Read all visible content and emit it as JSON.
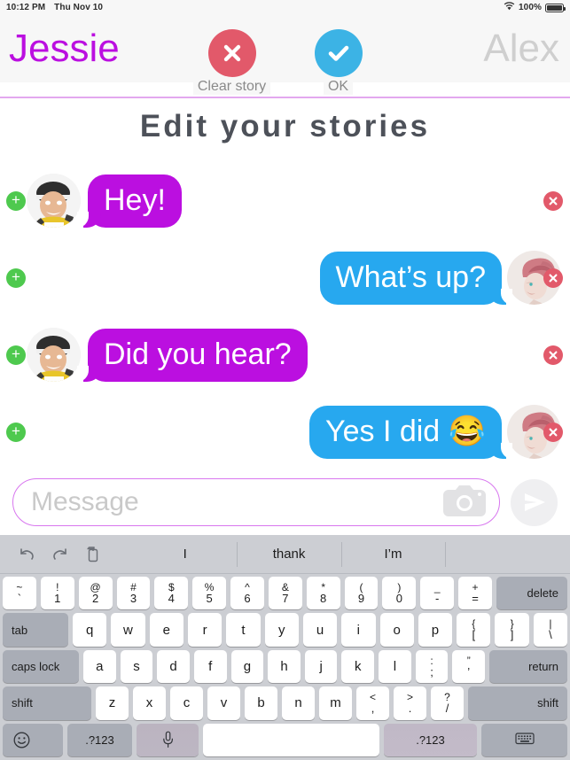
{
  "statusbar": {
    "time": "10:12 PM",
    "date": "Thu Nov 10",
    "battery": "100%"
  },
  "header": {
    "left_name": "Jessie",
    "right_name": "Alex",
    "clear_label": "Clear story",
    "ok_label": "OK"
  },
  "page_title": "Edit your stories",
  "messages": [
    {
      "text": "Hey!",
      "side": "in",
      "color": "purple"
    },
    {
      "text": "What’s up?",
      "side": "out",
      "color": "blue"
    },
    {
      "text": "Did you hear?",
      "side": "in",
      "color": "purple"
    },
    {
      "text": "Yes I did 😂",
      "side": "out",
      "color": "blue"
    }
  ],
  "input": {
    "placeholder": "Message",
    "value": ""
  },
  "keyboard": {
    "suggestions": [
      "I",
      "thank",
      "I’m"
    ],
    "tools": [
      "undo-icon",
      "redo-icon",
      "paste-icon"
    ],
    "row_num": [
      {
        "up": "~",
        "lo": "`"
      },
      {
        "up": "!",
        "lo": "1"
      },
      {
        "up": "@",
        "lo": "2"
      },
      {
        "up": "#",
        "lo": "3"
      },
      {
        "up": "$",
        "lo": "4"
      },
      {
        "up": "%",
        "lo": "5"
      },
      {
        "up": "^",
        "lo": "6"
      },
      {
        "up": "&",
        "lo": "7"
      },
      {
        "up": "*",
        "lo": "8"
      },
      {
        "up": "(",
        "lo": "9"
      },
      {
        "up": ")",
        "lo": "0"
      },
      {
        "up": "_",
        "lo": "-"
      },
      {
        "up": "+",
        "lo": "="
      }
    ],
    "delete_label": "delete",
    "tab_label": "tab",
    "row_q": [
      "q",
      "w",
      "e",
      "r",
      "t",
      "y",
      "u",
      "i",
      "o",
      "p"
    ],
    "row_q_dual": [
      {
        "up": "{",
        "lo": "["
      },
      {
        "up": "}",
        "lo": "]"
      },
      {
        "up": "|",
        "lo": "\\"
      }
    ],
    "caps_label": "caps lock",
    "row_a": [
      "a",
      "s",
      "d",
      "f",
      "g",
      "h",
      "j",
      "k",
      "l"
    ],
    "row_a_dual": [
      {
        "up": ":",
        "lo": ";"
      },
      {
        "up": "”",
        "lo": "’"
      }
    ],
    "return_label": "return",
    "shift_label": "shift",
    "row_z": [
      "z",
      "x",
      "c",
      "v",
      "b",
      "n",
      "m"
    ],
    "row_z_dual": [
      {
        "up": "<",
        "lo": ","
      },
      {
        "up": ">",
        "lo": "."
      },
      {
        "up": "?",
        "lo": "/"
      }
    ],
    "num_label": ".?123",
    "num_label_right": ".?123",
    "space_label": ""
  },
  "colors": {
    "purple": "#bb0fe0",
    "blue": "#27a8ef",
    "red": "#e2596a",
    "green": "#4ec94e",
    "sky": "#3cb3e5"
  }
}
